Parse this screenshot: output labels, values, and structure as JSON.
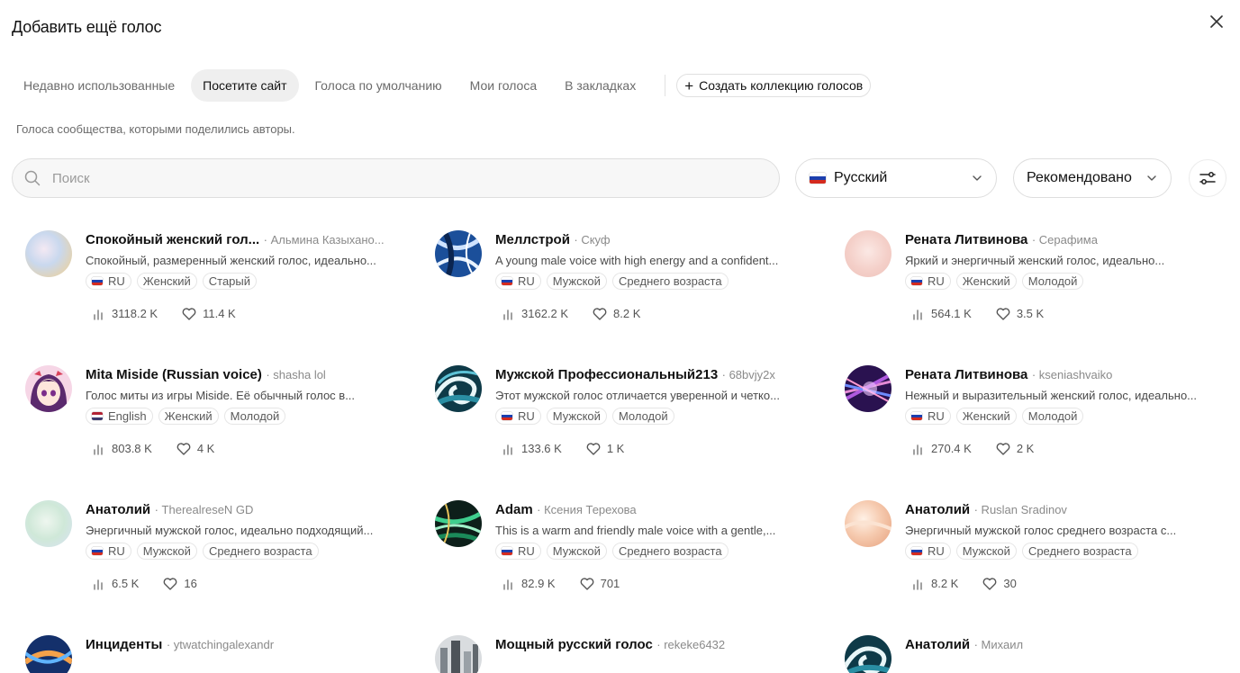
{
  "header": {
    "title": "Добавить ещё голос"
  },
  "tabs": [
    {
      "label": "Недавно использованные",
      "active": false
    },
    {
      "label": "Посетите сайт",
      "active": true
    },
    {
      "label": "Голоса по умолчанию",
      "active": false
    },
    {
      "label": "Мои голоса",
      "active": false
    },
    {
      "label": "В закладках",
      "active": false
    }
  ],
  "create_collection_label": "Создать коллекцию голосов",
  "subtitle": "Голоса сообщества, которыми поделились авторы.",
  "search": {
    "placeholder": "Поиск",
    "value": ""
  },
  "language_select": {
    "value": "Русский"
  },
  "sort_select": {
    "value": "Рекомендовано"
  },
  "colors": {
    "active_tab_bg": "#efefef",
    "search_bg": "#f7f7f7",
    "text_muted": "#6b6b6b"
  },
  "cards": [
    {
      "name": "Спокойный женский гол...",
      "author": "· Альмина Казыхано...",
      "desc": "Спокойный, размеренный женский голос, идеально...",
      "tags": [
        {
          "label": "RU",
          "flag": "ru"
        },
        {
          "label": "Женский"
        },
        {
          "label": "Старый"
        }
      ],
      "plays": "3118.2 K",
      "likes": "11.4 K",
      "avatar": "pastel-blue"
    },
    {
      "name": "Меллстрой",
      "author": "· Скуф",
      "desc": "A young male voice with high energy and a confident...",
      "tags": [
        {
          "label": "RU",
          "flag": "ru"
        },
        {
          "label": "Мужской"
        },
        {
          "label": "Среднего возраста"
        }
      ],
      "plays": "3162.2 K",
      "likes": "8.2 K",
      "avatar": "blue-swirl"
    },
    {
      "name": "Рената Литвинова",
      "author": "· Серафима",
      "desc": "Яркий и энергичный женский голос, идеально...",
      "tags": [
        {
          "label": "RU",
          "flag": "ru"
        },
        {
          "label": "Женский"
        },
        {
          "label": "Молодой"
        }
      ],
      "plays": "564.1 K",
      "likes": "3.5 K",
      "avatar": "pink-pastel"
    },
    {
      "name": "Mita Miside (Russian voice)",
      "author": "· shasha lol",
      "desc": "Голос миты из игры Miside. Её обычный голос в...",
      "tags": [
        {
          "label": "English",
          "flag": "us"
        },
        {
          "label": "Женский"
        },
        {
          "label": "Молодой"
        }
      ],
      "plays": "803.8 K",
      "likes": "4 K",
      "avatar": "anime-girl"
    },
    {
      "name": "Мужской Профессиональный213",
      "author": "· 68bvjy2x",
      "desc": "Этот мужской голос отличается уверенной и четко...",
      "tags": [
        {
          "label": "RU",
          "flag": "ru"
        },
        {
          "label": "Мужской"
        },
        {
          "label": "Молодой"
        }
      ],
      "plays": "133.6 K",
      "likes": "1 K",
      "avatar": "teal-wave"
    },
    {
      "name": "Рената Литвинова",
      "author": "· kseniashvaiko",
      "desc": "Нежный и выразительный женский голос, идеально...",
      "tags": [
        {
          "label": "RU",
          "flag": "ru"
        },
        {
          "label": "Женский"
        },
        {
          "label": "Молодой"
        }
      ],
      "plays": "270.4 K",
      "likes": "2 K",
      "avatar": "purple-rays"
    },
    {
      "name": "Анатолий",
      "author": "· TherealreseN GD",
      "desc": "Энергичный мужской голос, идеально подходящий...",
      "tags": [
        {
          "label": "RU",
          "flag": "ru"
        },
        {
          "label": "Мужской"
        },
        {
          "label": "Среднего возраста"
        }
      ],
      "plays": "6.5 K",
      "likes": "16",
      "avatar": "mint-pastel"
    },
    {
      "name": "Adam",
      "author": "· Ксения Терехова",
      "desc": "This is a warm and friendly male voice with a gentle,...",
      "tags": [
        {
          "label": "RU",
          "flag": "ru"
        },
        {
          "label": "Мужской"
        },
        {
          "label": "Среднего возраста"
        }
      ],
      "plays": "82.9 K",
      "likes": "701",
      "avatar": "green-tunnel"
    },
    {
      "name": "Анатолий",
      "author": "· Ruslan Sradinov",
      "desc": "Энергичный мужской голос среднего возраста с...",
      "tags": [
        {
          "label": "RU",
          "flag": "ru"
        },
        {
          "label": "Мужской"
        },
        {
          "label": "Среднего возраста"
        }
      ],
      "plays": "8.2 K",
      "likes": "30",
      "avatar": "peach-swirl"
    },
    {
      "name": "Инциденты",
      "author": "· ytwatchingalexandr",
      "desc": "",
      "tags": [],
      "plays": "",
      "likes": "",
      "avatar": "blue-orange"
    },
    {
      "name": "Мощный русский голос",
      "author": "· rekeke6432",
      "desc": "",
      "tags": [],
      "plays": "",
      "likes": "",
      "avatar": "gray-city"
    },
    {
      "name": "Анатолий",
      "author": "· Михаил",
      "desc": "",
      "tags": [],
      "plays": "",
      "likes": "",
      "avatar": "teal-wave"
    }
  ]
}
